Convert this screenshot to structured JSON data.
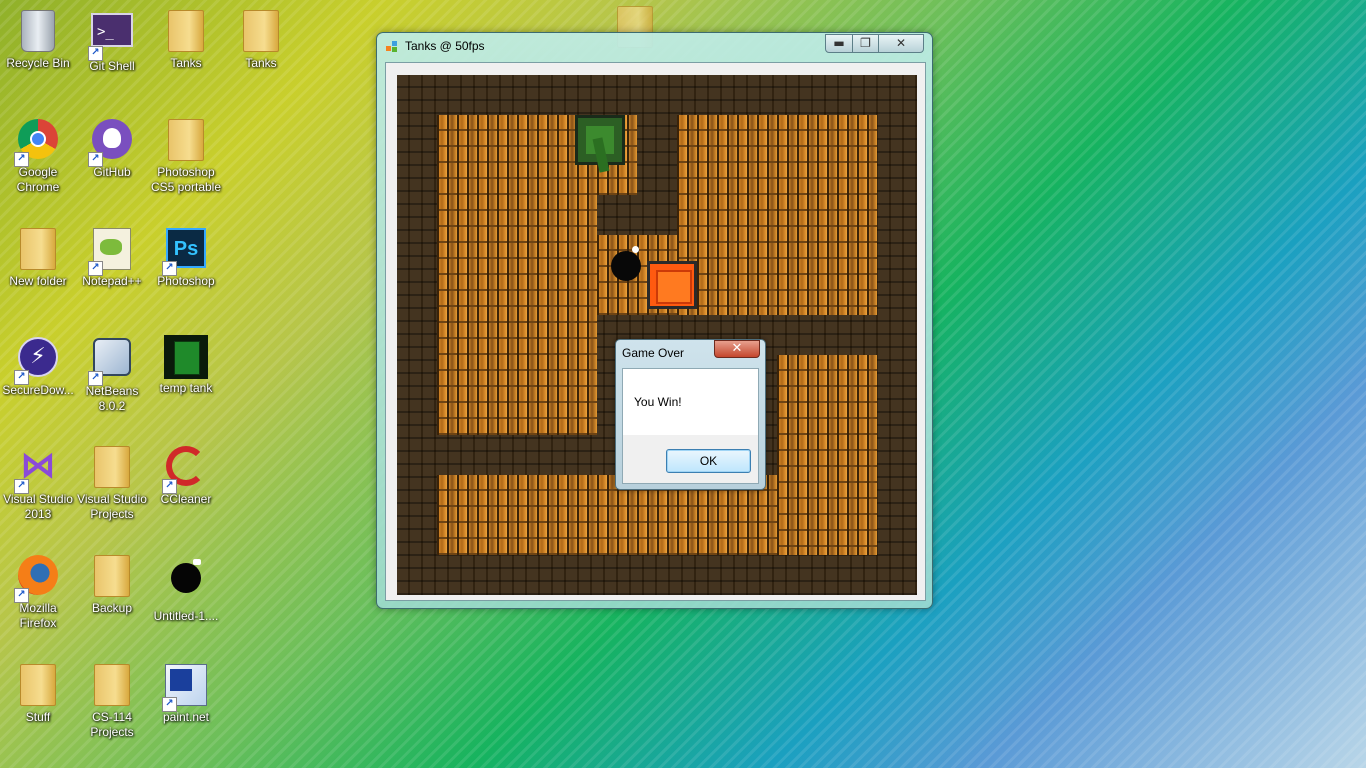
{
  "desktop": {
    "icons": [
      {
        "label": "Recycle Bin",
        "icon": "recycle-bin-icon",
        "shortcut": false
      },
      {
        "label": "Git Shell",
        "icon": "terminal-icon",
        "shortcut": true
      },
      {
        "label": "Tanks",
        "icon": "folder-icon",
        "shortcut": false
      },
      {
        "label": "Tanks",
        "icon": "zip-folder-icon",
        "shortcut": false
      },
      {
        "label": "Google Chrome",
        "icon": "chrome-icon",
        "shortcut": true
      },
      {
        "label": "GitHub",
        "icon": "github-icon",
        "shortcut": true
      },
      {
        "label": "Photoshop CS5 portable",
        "icon": "folder-icon",
        "shortcut": false
      },
      {
        "label": "New folder",
        "icon": "folder-icon",
        "shortcut": false
      },
      {
        "label": "Notepad++",
        "icon": "notepad-icon",
        "shortcut": true
      },
      {
        "label": "Photoshop",
        "icon": "photoshop-icon",
        "shortcut": true
      },
      {
        "label": "SecureDow...",
        "icon": "secure-download-icon",
        "shortcut": true
      },
      {
        "label": "NetBeans 8.0.2",
        "icon": "netbeans-icon",
        "shortcut": true
      },
      {
        "label": "temp tank",
        "icon": "tank-image-icon",
        "shortcut": false
      },
      {
        "label": "Visual Studio 2013",
        "icon": "visual-studio-icon",
        "shortcut": true
      },
      {
        "label": "Visual Studio Projects",
        "icon": "folder-icon",
        "shortcut": false
      },
      {
        "label": "CCleaner",
        "icon": "ccleaner-icon",
        "shortcut": true
      },
      {
        "label": "Mozilla Firefox",
        "icon": "firefox-icon",
        "shortcut": true
      },
      {
        "label": "Backup",
        "icon": "folder-icon",
        "shortcut": false
      },
      {
        "label": "Untitled-1....",
        "icon": "bomb-image-icon",
        "shortcut": false
      },
      {
        "label": "Stuff",
        "icon": "folder-icon",
        "shortcut": false
      },
      {
        "label": "CS-114 Projects",
        "icon": "folder-icon",
        "shortcut": false
      },
      {
        "label": "paint.net",
        "icon": "paintnet-icon",
        "shortcut": true
      }
    ]
  },
  "window": {
    "title": "Tanks @ 50fps",
    "controls": {
      "minimize": "▬",
      "maximize": "❐",
      "close": "✕"
    }
  },
  "dialog": {
    "title": "Game Over",
    "message": "You Win!",
    "ok_label": "OK",
    "close_glyph": "✕"
  }
}
